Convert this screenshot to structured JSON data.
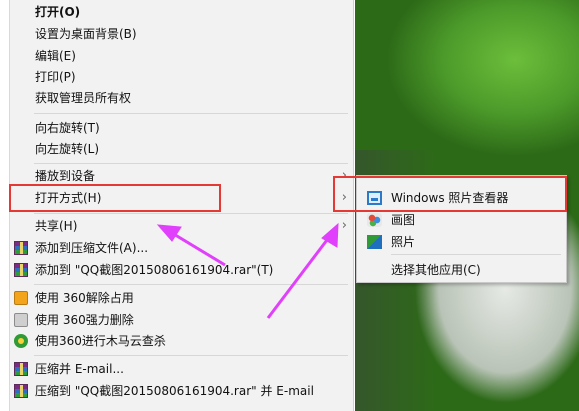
{
  "menu": {
    "items": [
      {
        "label": "打开(O)",
        "bold": true
      },
      {
        "label": "设置为桌面背景(B)"
      },
      {
        "label": "编辑(E)"
      },
      {
        "label": "打印(P)"
      },
      {
        "label": "获取管理员所有权"
      },
      {
        "label": "向右旋转(T)"
      },
      {
        "label": "向左旋转(L)"
      },
      {
        "label": "播放到设备"
      },
      {
        "label": "打开方式(H)"
      },
      {
        "label": "共享(H)"
      },
      {
        "label": "添加到压缩文件(A)..."
      },
      {
        "label": "添加到 \"QQ截图20150806161904.rar\"(T)"
      },
      {
        "label": "使用 360解除占用"
      },
      {
        "label": "使用 360强力删除"
      },
      {
        "label": "使用360进行木马云查杀"
      },
      {
        "label": "压缩并 E-mail..."
      },
      {
        "label": "压缩到 \"QQ截图20150806161904.rar\" 并 E-mail"
      }
    ]
  },
  "submenu": {
    "items": [
      {
        "label": "Windows 照片查看器"
      },
      {
        "label": "画图"
      },
      {
        "label": "照片"
      },
      {
        "label": "选择其他应用(C)"
      }
    ]
  },
  "icons": {
    "rar": "winrar-icon",
    "unlock360": "360-unlock-icon",
    "delete360": "360-delete-icon",
    "scan360": "360-scan-icon",
    "viewer": "photo-viewer-icon",
    "paint": "paint-icon",
    "photos": "photos-icon",
    "submenu_arrow": "chevron-right-icon"
  },
  "colors": {
    "highlight": "#e53935",
    "annotation_arrow": "#e040fb",
    "menu_bg": "#f2f2f2"
  }
}
